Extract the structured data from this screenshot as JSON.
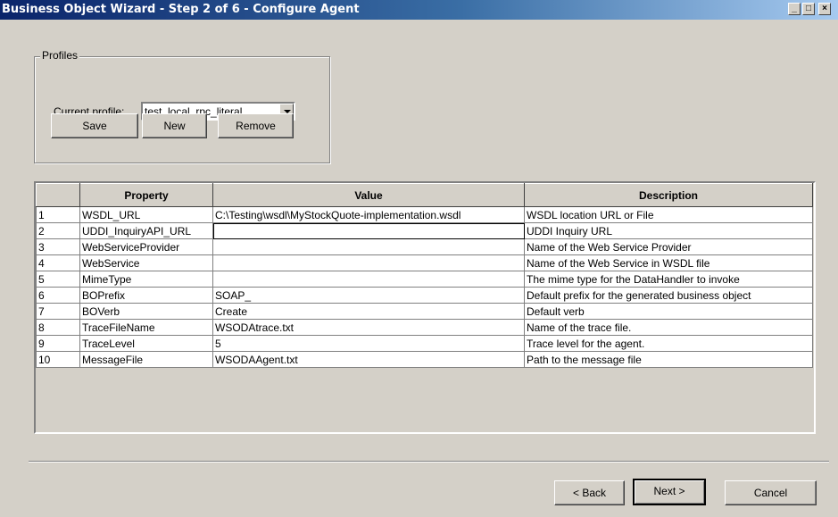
{
  "window": {
    "title": "Business Object Wizard - Step 2 of 6 - Configure Agent",
    "controls": [
      "_",
      "□",
      "×"
    ]
  },
  "profiles": {
    "group_label": "Profiles",
    "current_label": "Current profile:",
    "current_value": "test_local_rpc_literal",
    "save_label": "Save",
    "new_label": "New",
    "remove_label": "Remove"
  },
  "grid": {
    "headers": [
      "",
      "Property",
      "Value",
      "Description"
    ],
    "rows": [
      {
        "n": "1",
        "property": "WSDL_URL",
        "value": "C:\\Testing\\wsdl\\MyStockQuote-implementation.wsdl",
        "description": "WSDL location URL or File"
      },
      {
        "n": "2",
        "property": "UDDI_InquiryAPI_URL",
        "value": "",
        "description": "UDDI Inquiry URL"
      },
      {
        "n": "3",
        "property": "WebServiceProvider",
        "value": "",
        "description": "Name of the Web Service Provider"
      },
      {
        "n": "4",
        "property": "WebService",
        "value": "",
        "description": "Name of the Web Service in WSDL file"
      },
      {
        "n": "5",
        "property": "MimeType",
        "value": "",
        "description": "The mime type for the DataHandler to invoke"
      },
      {
        "n": "6",
        "property": "BOPrefix",
        "value": "SOAP_",
        "description": "Default prefix for the generated business object"
      },
      {
        "n": "7",
        "property": "BOVerb",
        "value": "Create",
        "description": "Default verb"
      },
      {
        "n": "8",
        "property": "TraceFileName",
        "value": "WSODAtrace.txt",
        "description": "Name of the trace file."
      },
      {
        "n": "9",
        "property": "TraceLevel",
        "value": "5",
        "description": "Trace level for the agent."
      },
      {
        "n": "10",
        "property": "MessageFile",
        "value": "WSODAAgent.txt",
        "description": "Path to the message file"
      }
    ]
  },
  "footer": {
    "back_label": "< Back",
    "next_label": "Next >",
    "cancel_label": "Cancel"
  }
}
